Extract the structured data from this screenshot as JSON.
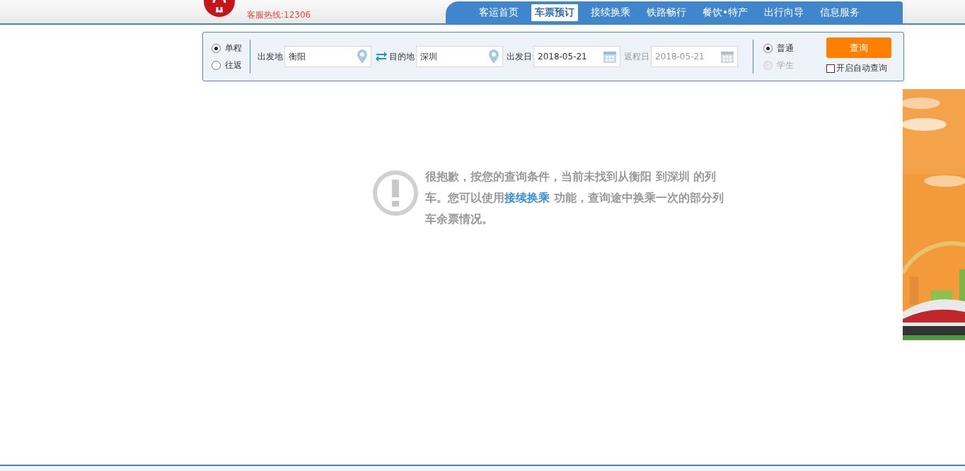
{
  "header": {
    "hotline": "客服热线:12306"
  },
  "nav": [
    {
      "label": "客运首页",
      "selected": false
    },
    {
      "label": "车票预订",
      "selected": true
    },
    {
      "label": "接续换乘",
      "selected": false
    },
    {
      "label": "铁路畅行",
      "selected": false
    },
    {
      "label": "餐饮•特产",
      "selected": false
    },
    {
      "label": "出行向导",
      "selected": false
    },
    {
      "label": "信息服务",
      "selected": false
    }
  ],
  "search": {
    "trip_types": [
      {
        "label": "单程",
        "selected": true
      },
      {
        "label": "往返",
        "selected": false
      }
    ],
    "from": {
      "label": "出发地",
      "value": "衡阳"
    },
    "to": {
      "label": "目的地",
      "value": "深圳"
    },
    "depart_date": {
      "label": "出发日",
      "value": "2018-05-21",
      "disabled": false
    },
    "return_date": {
      "label": "返程日",
      "value": "2018-05-21",
      "disabled": true
    },
    "passenger_types": [
      {
        "label": "普通",
        "selected": true,
        "disabled": false
      },
      {
        "label": "学生",
        "selected": false,
        "disabled": true
      }
    ],
    "query_button": "查询",
    "auto_query": {
      "label": "开启自动查询",
      "checked": false
    }
  },
  "message": {
    "before": "很抱歉，按您的查询条件，当前未找到从衡阳 到深圳 的列车。您可以使用",
    "link": "接续换乘",
    "after": " 功能，查询途中换乘一次的部分列车余票情况。"
  }
}
